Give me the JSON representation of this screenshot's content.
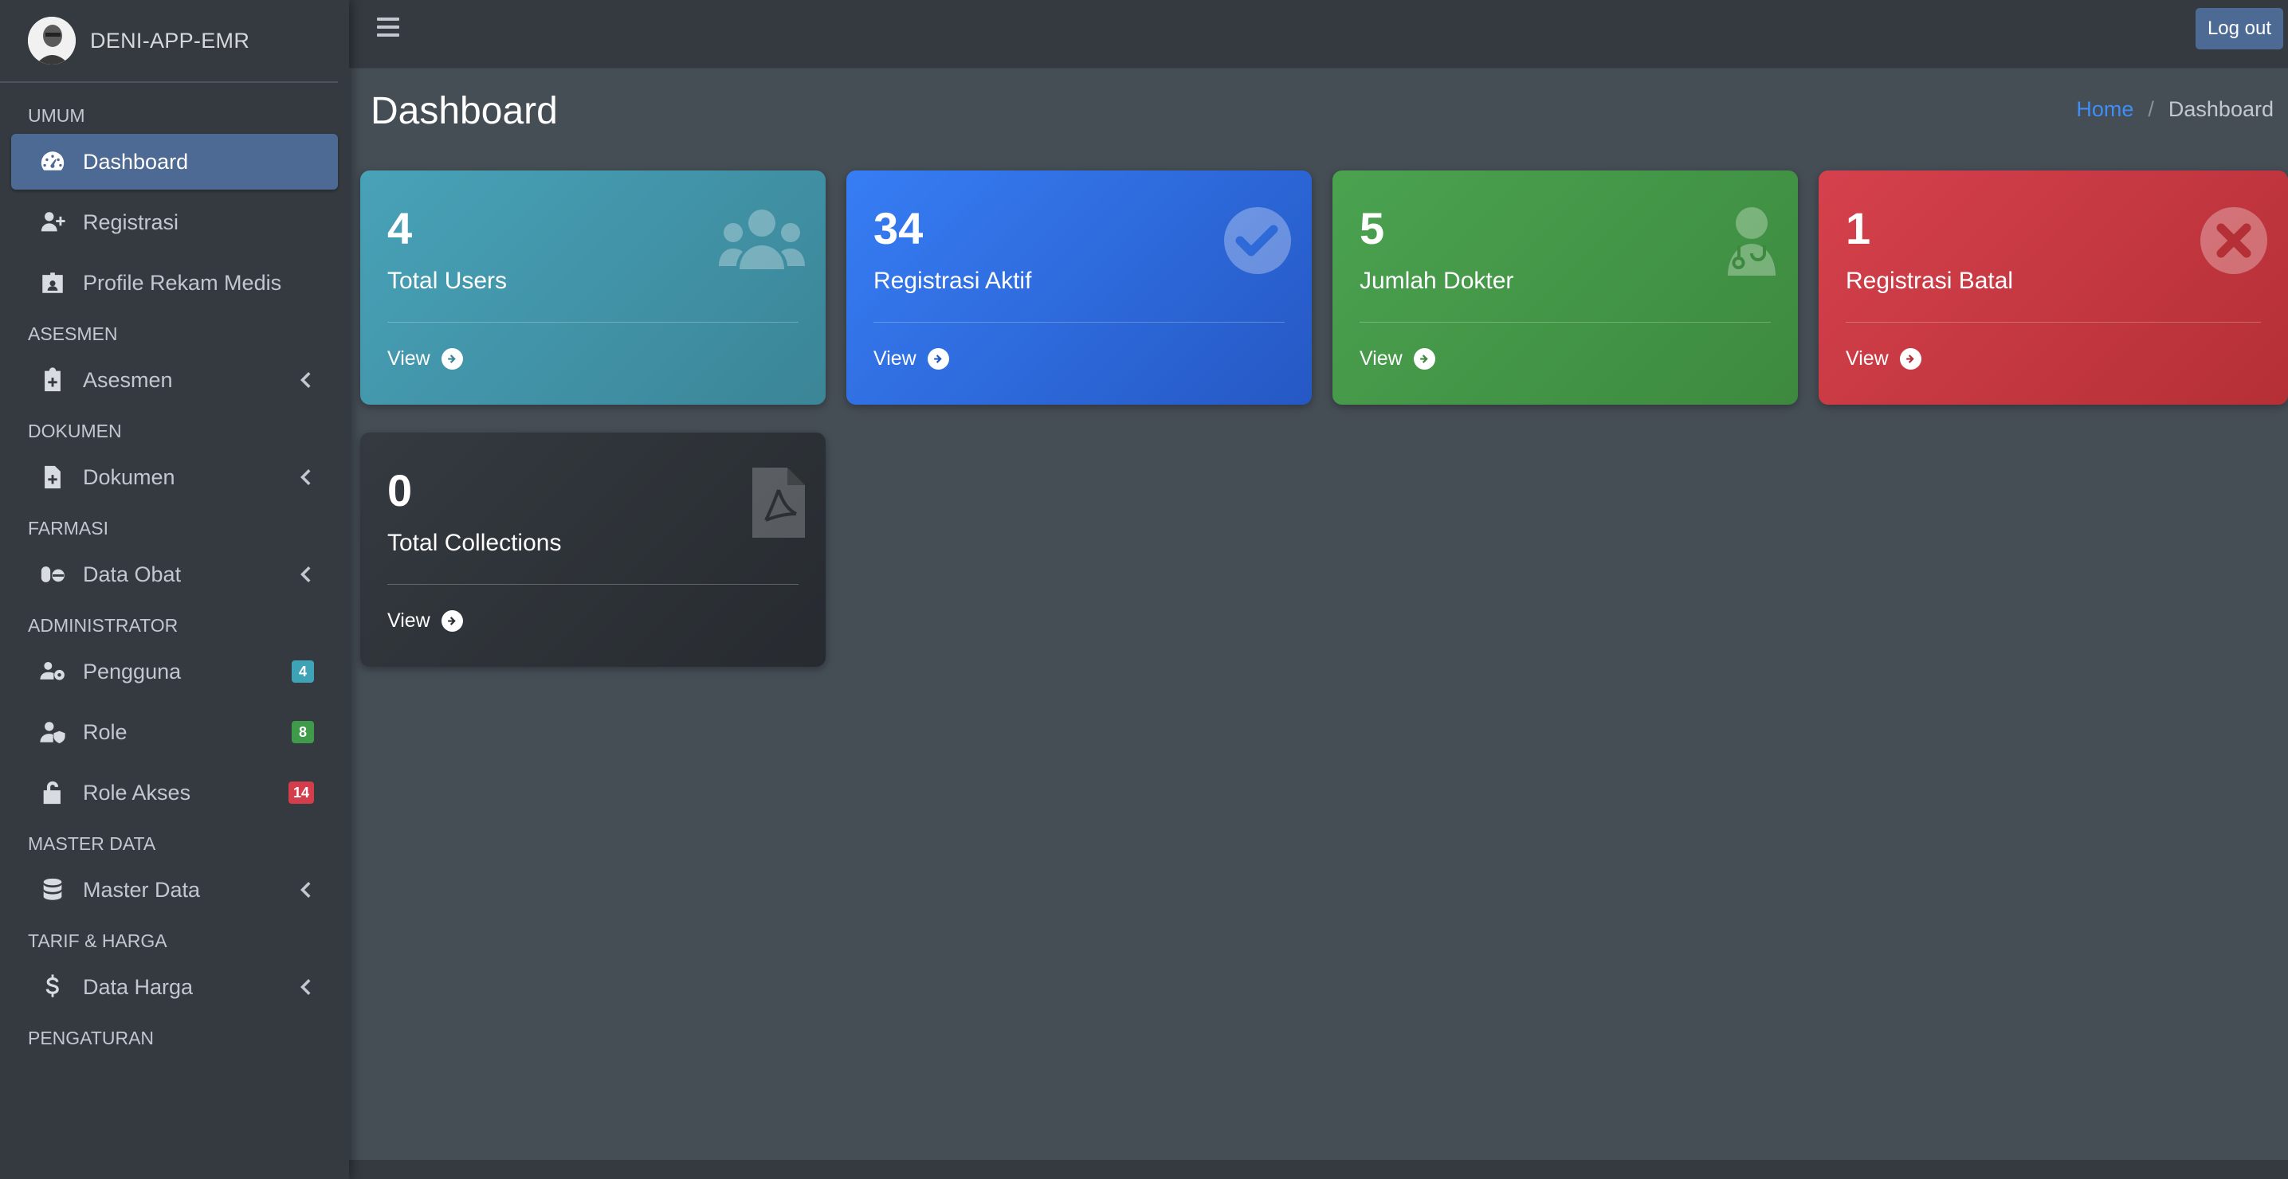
{
  "brand": {
    "name": "DENI-APP-EMR"
  },
  "topbar": {
    "menu_icon": "hamburger-icon",
    "logout_label": "Log out"
  },
  "page": {
    "title": "Dashboard"
  },
  "breadcrumb": {
    "home": "Home",
    "separator": "/",
    "current": "Dashboard"
  },
  "sidebar": {
    "sections": [
      {
        "header": "UMUM"
      },
      {
        "header": "ASESMEN"
      },
      {
        "header": "DOKUMEN"
      },
      {
        "header": "FARMASI"
      },
      {
        "header": "ADMINISTRATOR"
      },
      {
        "header": "MASTER DATA"
      },
      {
        "header": "TARIF & HARGA"
      },
      {
        "header": "PENGATURAN"
      }
    ],
    "items": [
      {
        "label": "Dashboard",
        "icon": "tachometer-icon",
        "active": true
      },
      {
        "label": "Registrasi",
        "icon": "user-plus-icon"
      },
      {
        "label": "Profile Rekam Medis",
        "icon": "id-badge-icon"
      },
      {
        "label": "Asesmen",
        "icon": "clipboard-medical-icon",
        "has_submenu": true
      },
      {
        "label": "Dokumen",
        "icon": "file-medical-icon",
        "has_submenu": true
      },
      {
        "label": "Data Obat",
        "icon": "pills-icon",
        "has_submenu": true
      },
      {
        "label": "Pengguna",
        "icon": "users-cog-icon",
        "badge": "4",
        "badge_color": "#3fa3b8"
      },
      {
        "label": "Role",
        "icon": "user-shield-icon",
        "badge": "8",
        "badge_color": "#3f9a4a"
      },
      {
        "label": "Role Akses",
        "icon": "unlock-icon",
        "badge": "14",
        "badge_color": "#d33d4c"
      },
      {
        "label": "Master Data",
        "icon": "database-icon",
        "has_submenu": true
      },
      {
        "label": "Data Harga",
        "icon": "dollar-icon",
        "has_submenu": true
      }
    ]
  },
  "cards": [
    {
      "value": "4",
      "label": "Total Users",
      "link": "View",
      "icon": "users-icon",
      "color": "#48a2b8"
    },
    {
      "value": "34",
      "label": "Registrasi Aktif",
      "link": "View",
      "icon": "check-circle-icon",
      "color": "#377df4"
    },
    {
      "value": "5",
      "label": "Jumlah Dokter",
      "link": "View",
      "icon": "user-md-icon",
      "color": "#4aa24f"
    },
    {
      "value": "1",
      "label": "Registrasi Batal",
      "link": "View",
      "icon": "times-circle-icon",
      "color": "#d5414c"
    },
    {
      "value": "0",
      "label": "Total Collections",
      "link": "View",
      "icon": "file-pdf-icon",
      "color": "#343a40"
    }
  ]
}
